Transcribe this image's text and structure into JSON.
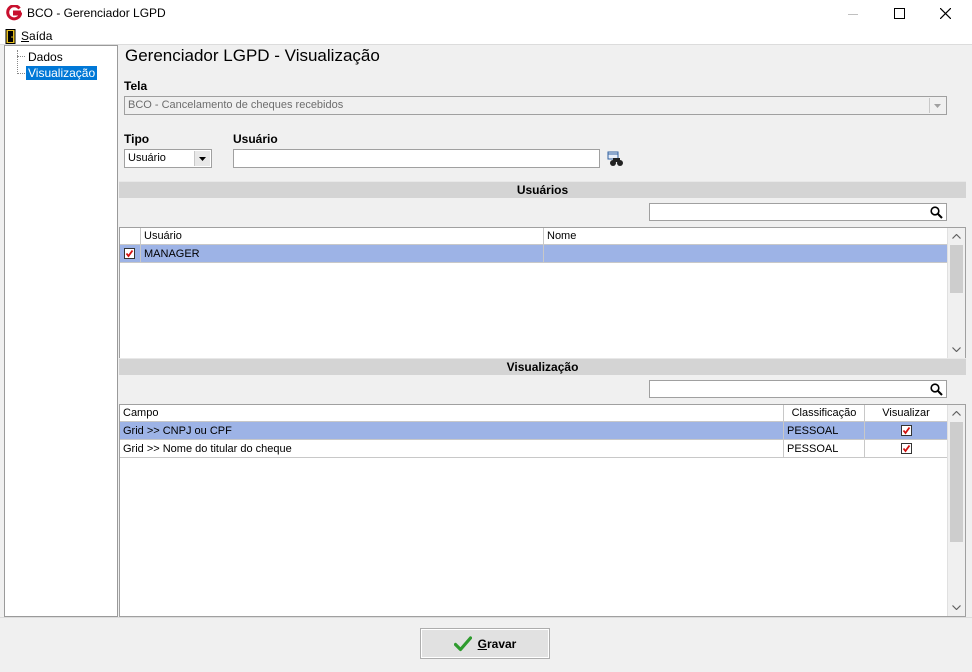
{
  "window": {
    "title": "BCO - Gerenciador LGPD",
    "icon_letter": "G",
    "brand_color": "#c8102e"
  },
  "menu": {
    "exit_label": "Saída",
    "exit_mnemonic": "S",
    "exit_rest": "aída"
  },
  "tree": {
    "items": [
      {
        "label": "Dados"
      },
      {
        "label": "Visualização",
        "selected": true
      }
    ]
  },
  "main": {
    "title": "Gerenciador LGPD - Visualização",
    "tela_label": "Tela",
    "tela_value": "BCO - Cancelamento de cheques recebidos",
    "tipo_label": "Tipo",
    "tipo_value": "Usuário",
    "usuario_label": "Usuário",
    "usuario_value": ""
  },
  "users_section": {
    "header": "Usuários",
    "search_value": "",
    "columns": [
      "Usuário",
      "Nome"
    ],
    "rows": [
      {
        "checked": true,
        "usuario": "MANAGER",
        "nome": ""
      }
    ]
  },
  "view_section": {
    "header": "Visualização",
    "search_value": "",
    "columns": [
      "Campo",
      "Classificação",
      "Visualizar"
    ],
    "rows": [
      {
        "campo": "Grid >> CNPJ ou CPF",
        "classificacao": "PESSOAL",
        "visualizar": true
      },
      {
        "campo": "Grid >> Nome do titular do cheque",
        "classificacao": "PESSOAL",
        "visualizar": true
      }
    ]
  },
  "footer": {
    "save_label": "Gravar",
    "save_mnemonic": "G",
    "save_rest": "ravar"
  },
  "colors": {
    "selection": "#9db3e6",
    "tree_selection": "#0078d7",
    "check_red": "#d01010",
    "save_check_green": "#2e9b2e"
  }
}
